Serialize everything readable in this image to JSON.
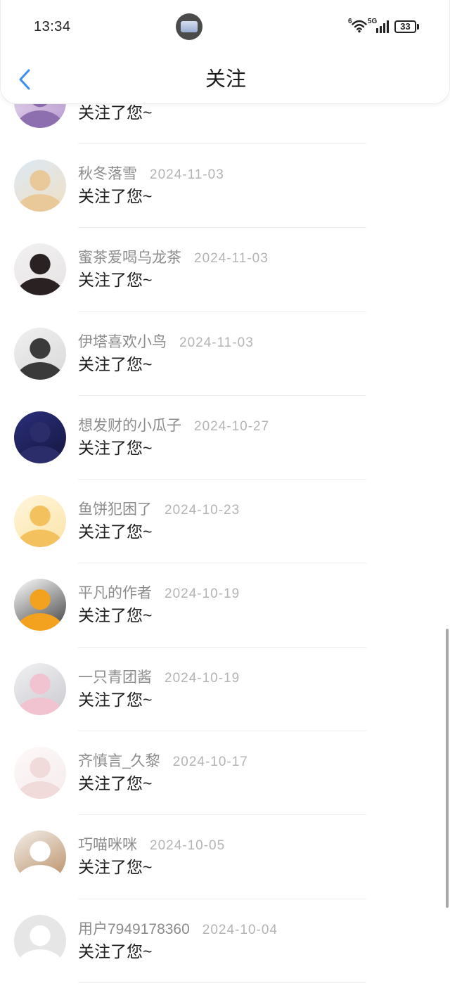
{
  "status_bar": {
    "time": "13:34",
    "wifi_label": "6",
    "network_label": "5G",
    "battery": "33",
    "icons": {
      "app_bubble": "floating-app-icon",
      "wifi": "wifi-icon",
      "signal": "signal-icon",
      "battery": "battery-icon"
    }
  },
  "header": {
    "title": "关注",
    "back_icon": "chevron-left-icon"
  },
  "colors": {
    "accent": "#3a8ef0",
    "title_text": "#1a1a1a",
    "name_text": "#8c8c8c",
    "date_text": "#b4b4b4",
    "message_text": "#1e1e1e",
    "divider": "#efefef",
    "scrollbar": "#a9a9a9"
  },
  "list": {
    "items": [
      {
        "message": "关注了您~",
        "avatar_colors": [
          "#f3e8f4",
          "#b395cf",
          "#8d6fb0"
        ]
      },
      {
        "name": "秋冬落雪",
        "date": "2024-11-03",
        "message": "关注了您~",
        "avatar_colors": [
          "#dce9f4",
          "#f0dfc4",
          "#e9c89a"
        ]
      },
      {
        "name": "蜜茶爱喝乌龙茶",
        "date": "2024-11-03",
        "message": "关注了您~",
        "avatar_colors": [
          "#f2f1f1",
          "#e6e3e3",
          "#2a2222"
        ]
      },
      {
        "name": "伊塔喜欢小鸟",
        "date": "2024-11-03",
        "message": "关注了您~",
        "avatar_colors": [
          "#f0f0f0",
          "#d8d8d8",
          "#3a3a3a"
        ]
      },
      {
        "name": "想发财的小瓜子",
        "date": "2024-10-27",
        "message": "关注了您~",
        "avatar_colors": [
          "#2a2f7a",
          "#15163f",
          "#2b2c6a"
        ]
      },
      {
        "name": "鱼饼犯困了",
        "date": "2024-10-23",
        "message": "关注了您~",
        "avatar_colors": [
          "#fff6dc",
          "#fbe3a8",
          "#f3c15e"
        ]
      },
      {
        "name": "平凡的作者",
        "date": "2024-10-19",
        "message": "关注了您~",
        "avatar_colors": [
          "#ffffff",
          "#3d3d3d",
          "#f2a21f"
        ]
      },
      {
        "name": "一只青团酱",
        "date": "2024-10-19",
        "message": "关注了您~",
        "avatar_colors": [
          "#f1f1f3",
          "#c9c9cf",
          "#f1c3d1"
        ]
      },
      {
        "name": "齐慎言_久黎",
        "date": "2024-10-17",
        "message": "关注了您~",
        "avatar_colors": [
          "#fdf8f8",
          "#f6ecec",
          "#f1dada"
        ]
      },
      {
        "name": "巧喵咪咪",
        "date": "2024-10-05",
        "message": "关注了您~",
        "avatar_colors": [
          "#f3efea",
          "#b88d63",
          "#ffffff"
        ]
      },
      {
        "name": "用户7949178360",
        "date": "2024-10-04",
        "message": "关注了您~",
        "avatar_colors": [
          "#e6e6e6",
          "#e6e6e6",
          "#ffffff"
        ]
      }
    ]
  },
  "scrollbar": {
    "scroll_position_percent": 88.7,
    "visible_content_percent": 28.3
  }
}
